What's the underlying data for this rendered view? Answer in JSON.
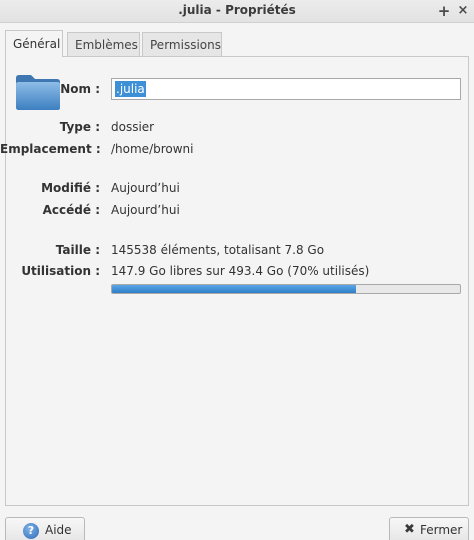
{
  "window": {
    "title": ".julia - Propriétés",
    "pin_glyph": "+",
    "close_glyph": "×"
  },
  "tabs": [
    {
      "label": "Général",
      "active": true
    },
    {
      "label": "Emblèmes",
      "active": false
    },
    {
      "label": "Permissions",
      "active": false
    }
  ],
  "general": {
    "name_label": "Nom :",
    "name_value": ".julia",
    "type_label": "Type :",
    "type_value": "dossier",
    "location_label": "Emplacement :",
    "location_value": "/home/browni",
    "modified_label": "Modifié :",
    "modified_value": "Aujourd’hui",
    "accessed_label": "Accédé :",
    "accessed_value": "Aujourd’hui",
    "size_label": "Taille :",
    "size_value": "145538 éléments, totalisant 7.8 Go",
    "usage_label": "Utilisation :",
    "usage_value": "147.9 Go libres sur 493.4 Go (70% utilisés)",
    "usage_fraction": 0.7
  },
  "buttons": {
    "help_label": "Aide",
    "help_glyph": "?",
    "close_label": "Fermer",
    "close_glyph": "✖"
  },
  "colors": {
    "accent": "#3d8fd6",
    "folder": "#4f8fc9"
  }
}
